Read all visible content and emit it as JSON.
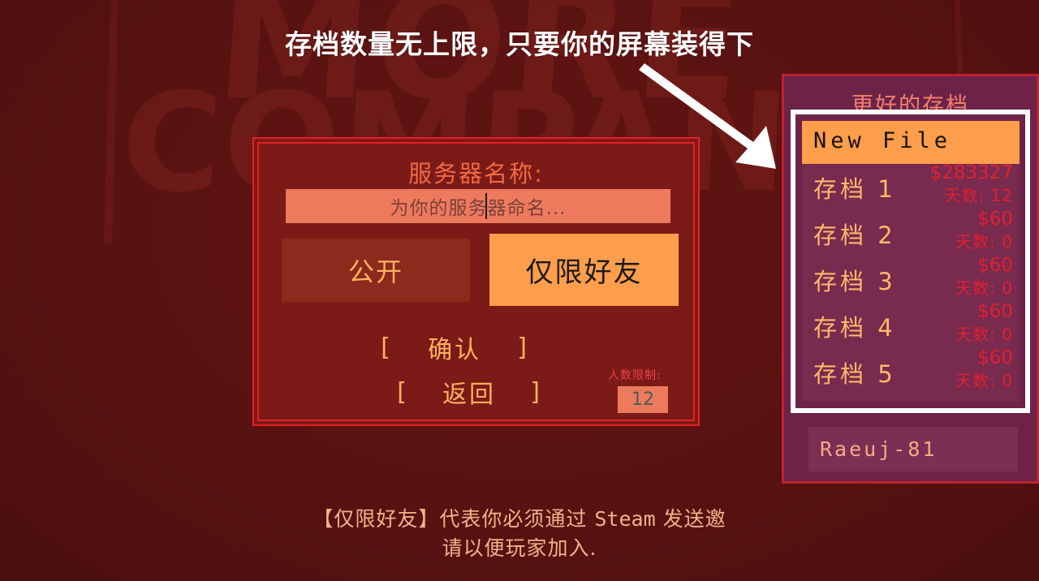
{
  "annotation": {
    "text": "存档数量无上限，只要你的屏幕装得下",
    "arrow_icon": "arrow-down-right-icon",
    "arrow_color": "#ffffff"
  },
  "background": {
    "logo_line1": "MORE",
    "logo_line2": "COMPANY",
    "base_color": "#5c1312"
  },
  "host_dialog": {
    "title": "服务器名称:",
    "name_input": {
      "value": "",
      "placeholder": "为你的服务器命名...",
      "background": "#ee7a5d"
    },
    "visibility": {
      "public_label": "公开",
      "friends_label": "仅限好友",
      "selected": "仅限好友"
    },
    "confirm": {
      "left_bracket": "[",
      "label": "确认",
      "right_bracket": "]"
    },
    "back": {
      "left_bracket": "[",
      "label": "返回",
      "right_bracket": "]"
    },
    "max_players": {
      "label": "人数限制:",
      "value": "12"
    },
    "border_color": "#e81f25",
    "background": "#7c1a17"
  },
  "footer_help": {
    "line1_prefix": "【仅限好友】代表你必须通过 ",
    "line1_mono": "Steam",
    "line1_suffix": " 发送邀",
    "line2": "请以便玩家加入."
  },
  "save_panel": {
    "title": "更好的存档",
    "highlight_border_color": "#ffffff",
    "background": "#6d2348",
    "border_color": "#c02130",
    "rows": [
      {
        "name": "New File",
        "money": "",
        "days": "",
        "is_new": true
      },
      {
        "name": "存档 1",
        "money": "$283327",
        "days": "天数: 12",
        "is_new": false
      },
      {
        "name": "存档 2",
        "money": "$60",
        "days": "天数: 0",
        "is_new": false
      },
      {
        "name": "存档 3",
        "money": "$60",
        "days": "天数: 0",
        "is_new": false
      },
      {
        "name": "存档 4",
        "money": "$60",
        "days": "天数: 0",
        "is_new": false
      },
      {
        "name": "存档 5",
        "money": "$60",
        "days": "天数: 0",
        "is_new": false
      }
    ],
    "name_field": {
      "value": "Raeuj-81"
    }
  }
}
